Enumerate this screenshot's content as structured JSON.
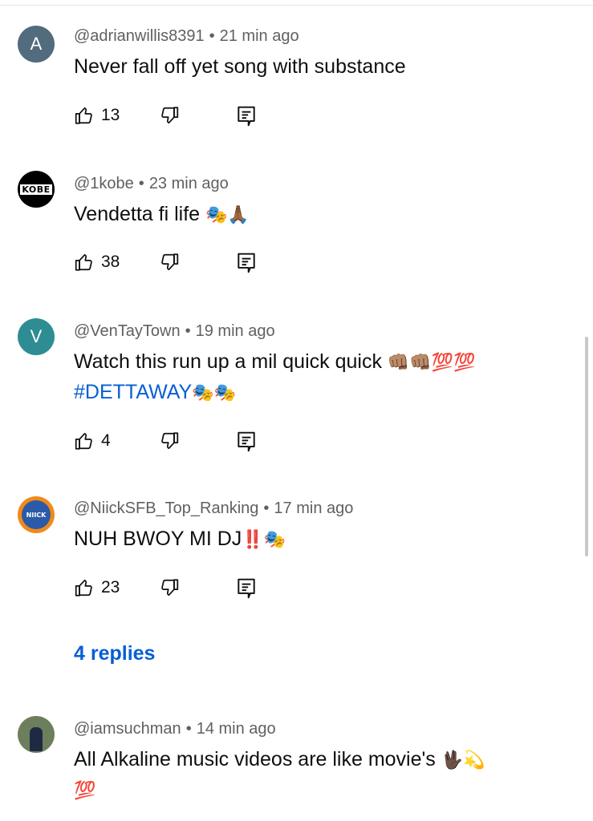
{
  "comments": [
    {
      "avatar_letter": "A",
      "avatar_color": "#526b7d",
      "author": "@adrianwillis8391",
      "time": "21 min ago",
      "text": "Never fall off yet song with substance",
      "likes": "13"
    },
    {
      "avatar_text": "KOBE",
      "author": "@1kobe",
      "time": "23 min ago",
      "text": "Vendetta fi life",
      "emojis": "🎭🙏🏾",
      "likes": "38"
    },
    {
      "avatar_letter": "V",
      "avatar_color": "#2d8d93",
      "author": "@VenTayTown",
      "time": "19 min ago",
      "text": "Watch this run up a mil quick quick",
      "emojis": "👊🏽👊🏽💯💯",
      "hashtag": "#DETTAWAY",
      "emojis2": "🎭🎭",
      "likes": "4"
    },
    {
      "avatar_text": "NIICK",
      "author": "@NiickSFB_Top_Ranking",
      "time": "17 min ago",
      "text": "NUH BWOY MI DJ",
      "emojis": "‼️🎭",
      "likes": "23",
      "replies": "4 replies"
    },
    {
      "author": "@iamsuchman",
      "time": "14 min ago",
      "text": "All Alkaline music videos are like movie's",
      "emojis": "🖖🏿💫",
      "emojis2": "💯"
    }
  ],
  "icons": [
    "like-icon",
    "dislike-icon",
    "reply-icon"
  ],
  "colors": {
    "link": "#065fd4",
    "meta": "#606060",
    "text": "#0f0f0f"
  }
}
